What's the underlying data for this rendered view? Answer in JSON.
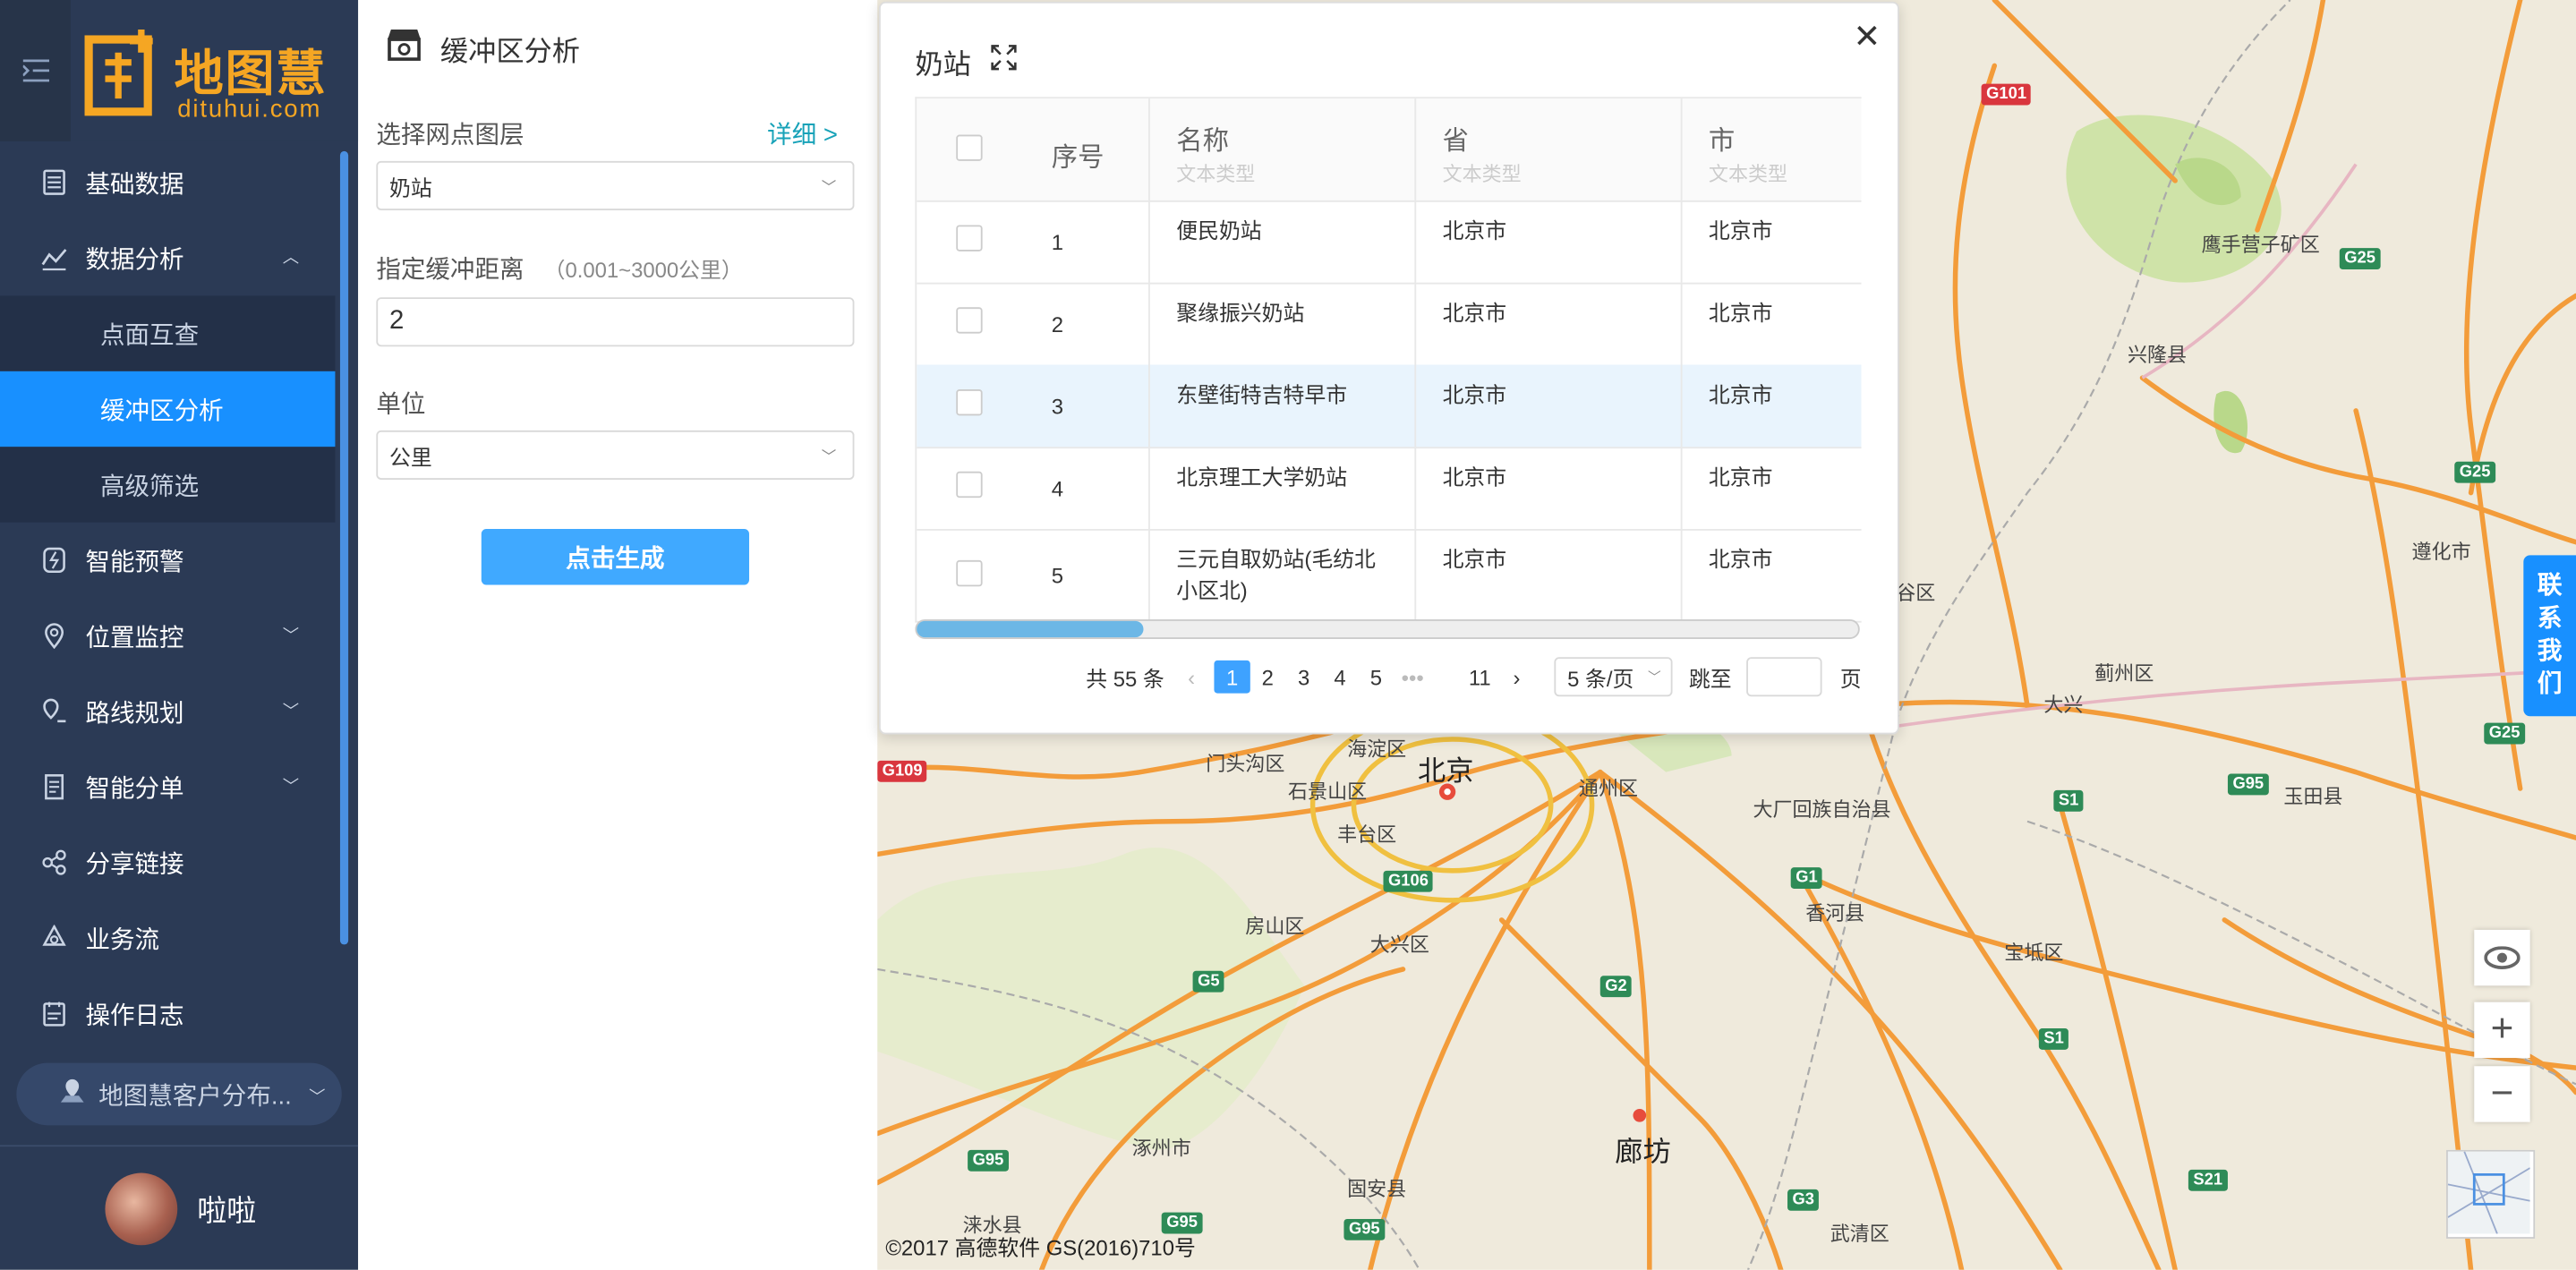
{
  "app": {
    "logo_cn": "地图慧",
    "logo_en": "dituhui.com",
    "collapse_icon": "menu-fold-icon",
    "colors": {
      "sidebar": "#2b3a55",
      "accent": "#1890ff",
      "logo": "#f5a623",
      "map_road": "#f39c3a"
    }
  },
  "sidebar": {
    "items": [
      {
        "label": "基础数据",
        "icon": "database-icon"
      },
      {
        "label": "数据分析",
        "icon": "analysis-icon",
        "expanded": true,
        "children": [
          {
            "label": "点面互查"
          },
          {
            "label": "缓冲区分析",
            "active": true
          },
          {
            "label": "高级筛选"
          }
        ]
      },
      {
        "label": "智能预警",
        "icon": "alert-icon"
      },
      {
        "label": "位置监控",
        "icon": "location-icon"
      },
      {
        "label": "路线规划",
        "icon": "route-icon"
      },
      {
        "label": "智能分单",
        "icon": "dispatch-icon"
      },
      {
        "label": "分享链接",
        "icon": "share-icon"
      },
      {
        "label": "业务流",
        "icon": "workflow-icon"
      },
      {
        "label": "操作日志",
        "icon": "log-icon"
      }
    ],
    "customer_map": "地图慧客户分布...",
    "user_name": "啦啦"
  },
  "panel": {
    "title": "缓冲区分析",
    "layer_label": "选择网点图层",
    "detail_link": "详细 >",
    "layer_value": "奶站",
    "distance_label": "指定缓冲距离",
    "distance_hint": "（0.001~3000公里）",
    "distance_value": "2",
    "unit_label": "单位",
    "unit_value": "公里",
    "generate_button": "点击生成"
  },
  "popup": {
    "title": "奶站",
    "columns": [
      {
        "label": "序号"
      },
      {
        "label": "名称",
        "type": "文本类型"
      },
      {
        "label": "省",
        "type": "文本类型"
      },
      {
        "label": "市",
        "type": "文本类型"
      }
    ],
    "rows": [
      {
        "no": "1",
        "name": "便民奶站",
        "province": "北京市",
        "city": "北京市"
      },
      {
        "no": "2",
        "name": "聚缘振兴奶站",
        "province": "北京市",
        "city": "北京市"
      },
      {
        "no": "3",
        "name": "东壁街特吉特早市",
        "province": "北京市",
        "city": "北京市",
        "highlighted": true
      },
      {
        "no": "4",
        "name": "北京理工大学奶站",
        "province": "北京市",
        "city": "北京市"
      },
      {
        "no": "5",
        "name": "三元自取奶站(毛纺北小区北)",
        "province": "北京市",
        "city": "北京市"
      }
    ],
    "pagination": {
      "total": "共 55 条",
      "pages": [
        "1",
        "2",
        "3",
        "4",
        "5"
      ],
      "ellipsis": "•••",
      "last_page": "11",
      "current": "1",
      "page_size": "5 条/页",
      "jump_label": "跳至",
      "page_suffix": "页"
    }
  },
  "map": {
    "labels": [
      "北京",
      "廊坊",
      "门头沟区",
      "海淀区",
      "石景山区",
      "丰台区",
      "通州区",
      "大厂回族自治县",
      "香河县",
      "宝坻区",
      "蓟州区",
      "兴隆县",
      "鹰手营子矿区",
      "遵化市",
      "玉田县",
      "房山区",
      "大兴区",
      "涿州市",
      "固安县",
      "涞水县",
      "武清区",
      "大兴",
      "谷区"
    ],
    "shields": [
      "G101",
      "G25",
      "G25",
      "G25",
      "G109",
      "G106",
      "G1",
      "S1",
      "G95",
      "G5",
      "G2",
      "S1",
      "G95",
      "G95",
      "G95",
      "G3",
      "S21",
      "G95"
    ],
    "copyright": "©2017 高德软件 GS(2016)710号",
    "contact_chars": [
      "联",
      "系",
      "我",
      "们"
    ],
    "controls": [
      "eye-icon",
      "zoom-in-icon",
      "zoom-out-icon"
    ]
  }
}
